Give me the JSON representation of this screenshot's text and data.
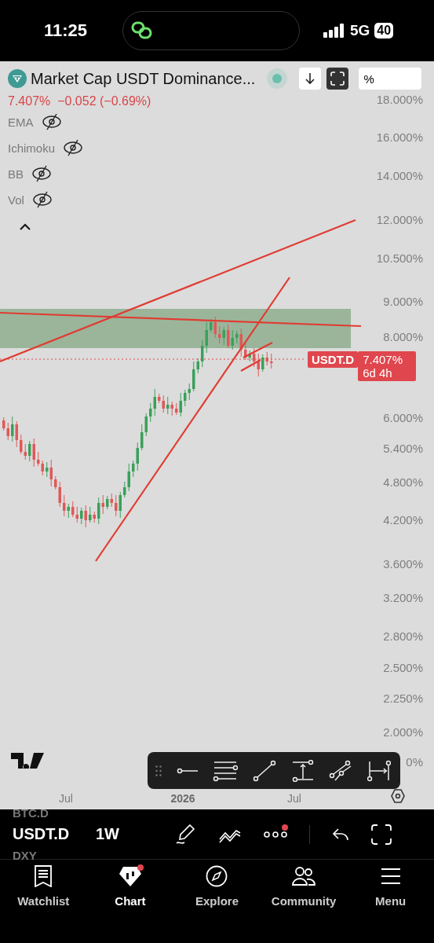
{
  "status_bar": {
    "time": "11:25",
    "network": "5G",
    "battery": "40"
  },
  "header": {
    "title": "Market Cap USDT Dominance...",
    "change": "7.407%  −0.052 (−0.69%)",
    "scale": "%"
  },
  "indicators": [
    {
      "name": "EMA",
      "hidden": true
    },
    {
      "name": "Ichimoku",
      "hidden": true
    },
    {
      "name": "BB",
      "hidden": true
    },
    {
      "name": "Vol",
      "hidden": true
    }
  ],
  "price_axis": [
    "18.000%",
    "16.000%",
    "14.000%",
    "12.000%",
    "10.500%",
    "9.000%",
    "8.000%",
    "6.000%",
    "5.400%",
    "4.800%",
    "4.200%",
    "3.600%",
    "3.200%",
    "2.800%",
    "2.500%",
    "2.250%",
    "2.000%",
    "0%"
  ],
  "price_tag": {
    "symbol": "USDT.D",
    "price": "7.407%",
    "countdown": "6d 4h"
  },
  "time_axis": [
    {
      "label": "Jul",
      "bold": false
    },
    {
      "label": "2026",
      "bold": true
    },
    {
      "label": "Jul",
      "bold": false
    }
  ],
  "toolbar": {
    "symbol_above": "BTC.D",
    "symbol": "USDT.D",
    "symbol_below": "DXY",
    "interval": "1W",
    "more_badge": true
  },
  "nav": [
    {
      "label": "Watchlist",
      "selected": false,
      "badge": false
    },
    {
      "label": "Chart",
      "selected": true,
      "badge": true
    },
    {
      "label": "Explore",
      "selected": false,
      "badge": false
    },
    {
      "label": "Community",
      "selected": false,
      "badge": false
    },
    {
      "label": "Menu",
      "selected": false,
      "badge": false
    }
  ]
}
